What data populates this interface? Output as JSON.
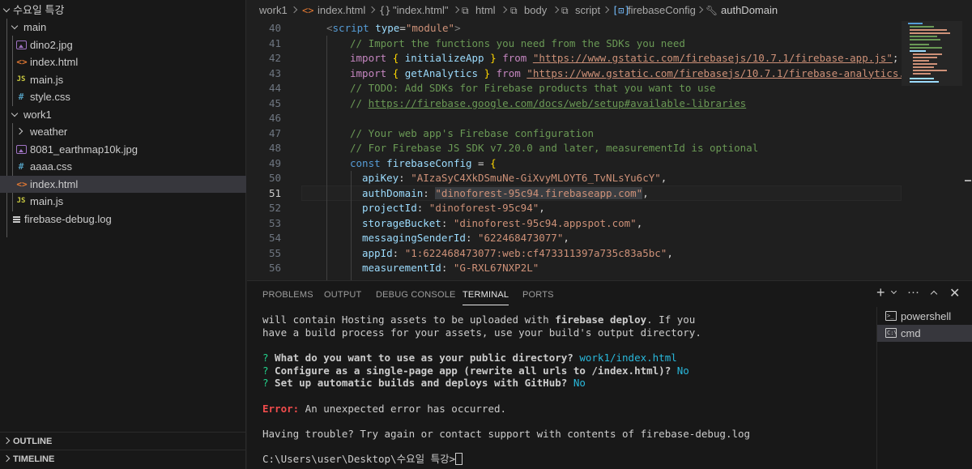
{
  "explorer": {
    "root": "수요일 특강",
    "items": [
      {
        "label": "main",
        "type": "folder"
      },
      {
        "label": "dino2.jpg",
        "type": "img"
      },
      {
        "label": "index.html",
        "type": "html"
      },
      {
        "label": "main.js",
        "type": "js"
      },
      {
        "label": "style.css",
        "type": "css"
      },
      {
        "label": "work1",
        "type": "folder"
      },
      {
        "label": "weather",
        "type": "folder"
      },
      {
        "label": "8081_earthmap10k.jpg",
        "type": "img"
      },
      {
        "label": "aaaa.css",
        "type": "css"
      },
      {
        "label": "index.html",
        "type": "html"
      },
      {
        "label": "main.js",
        "type": "js"
      },
      {
        "label": "firebase-debug.log",
        "type": "log"
      }
    ],
    "outline": "OUTLINE",
    "timeline": "TIMELINE"
  },
  "breadcrumb": {
    "items": [
      "work1",
      "index.html",
      "\"index.html\"",
      "html",
      "body",
      "script",
      "firebaseConfig",
      "authDomain"
    ]
  },
  "editor": {
    "line_numbers": [
      "40",
      "41",
      "42",
      "43",
      "44",
      "45",
      "46",
      "47",
      "48",
      "49",
      "50",
      "51",
      "52",
      "53",
      "54",
      "55",
      "56"
    ],
    "active_line": "51",
    "tokens": {
      "script_open": "<",
      "script_tag": "script",
      "type_attr": "type",
      "eq": "=",
      "module_str": "\"module\"",
      "gt": ">",
      "c41": "// Import the functions you need from the SDKs you need",
      "import": "import",
      "lbrace": "{",
      "rbrace": "}",
      "initializeApp": "initializeApp",
      "from": "from",
      "url42": "\"https://www.gstatic.com/firebasejs/10.7.1/firebase-app.js\"",
      "semi": ";",
      "getAnalytics": "getAnalytics",
      "url43": "\"https://www.gstatic.com/firebasejs/10.7.1/firebase-analytics.",
      "c44": "// TODO: Add SDKs for Firebase products that you want to use",
      "c45_prefix": "// ",
      "c45_link": "https://firebase.google.com/docs/web/setup#available-libraries",
      "c47": "// Your web app's Firebase configuration",
      "c48": "// For Firebase JS SDK v7.20.0 and later, measurementId is optional",
      "const": "const",
      "firebaseConfig": "firebaseConfig",
      "assign": " = ",
      "apiKey": "apiKey",
      "apiKey_val": "\"AIzaSyC4XkDSmuNe-GiXvyMLOYT6_TvNLsYu6cY\"",
      "authDomain": "authDomain",
      "authDomain_val": "\"dinoforest-95c94.firebaseapp.com\"",
      "projectId": "projectId",
      "projectId_val": "\"dinoforest-95c94\"",
      "storageBucket": "storageBucket",
      "storageBucket_val": "\"dinoforest-95c94.appspot.com\"",
      "messagingSenderId": "messagingSenderId",
      "messagingSenderId_val": "\"622468473077\"",
      "appId": "appId",
      "appId_val": "\"1:622468473077:web:cf473311397a735c83a5bc\"",
      "measurementId": "measurementId",
      "measurementId_val": "\"G-RXL67NXP2L\"",
      "colon": ": ",
      "comma": ","
    }
  },
  "panel": {
    "tabs": [
      "PROBLEMS",
      "OUTPUT",
      "DEBUG CONSOLE",
      "TERMINAL",
      "PORTS"
    ],
    "active_tab": "TERMINAL",
    "actions": {
      "add": "+",
      "more": "···"
    },
    "terminal_lines": {
      "l1a": "will contain Hosting assets to be uploaded with ",
      "l1b": "firebase deploy",
      "l1c": ". If you",
      "l2": "have a build process for your assets, use your build's output directory.",
      "q": "?",
      "q1": " What do you want to use as your public directory? ",
      "a1": "work1/index.html",
      "q2": " Configure as a single-page app (rewrite all urls to /index.html)? ",
      "a2": "No",
      "q3": " Set up automatic builds and deploys with GitHub? ",
      "a3": "No",
      "err_label": "Error:",
      "err_msg": " An unexpected error has occurred.",
      "trouble": "Having trouble? Try again or contact support with contents of firebase-debug.log",
      "prompt": "C:\\Users\\user\\Desktop\\수요일 특강>"
    },
    "terminals": [
      {
        "label": "powershell",
        "icon": ">_"
      },
      {
        "label": "cmd",
        "icon": "C:\\"
      }
    ]
  },
  "colors": {
    "background": "#1f1f1f",
    "sidebar": "#181818",
    "selection": "#37373d",
    "string": "#ce9178",
    "comment": "#6a9955",
    "keyword": "#c586c0"
  }
}
